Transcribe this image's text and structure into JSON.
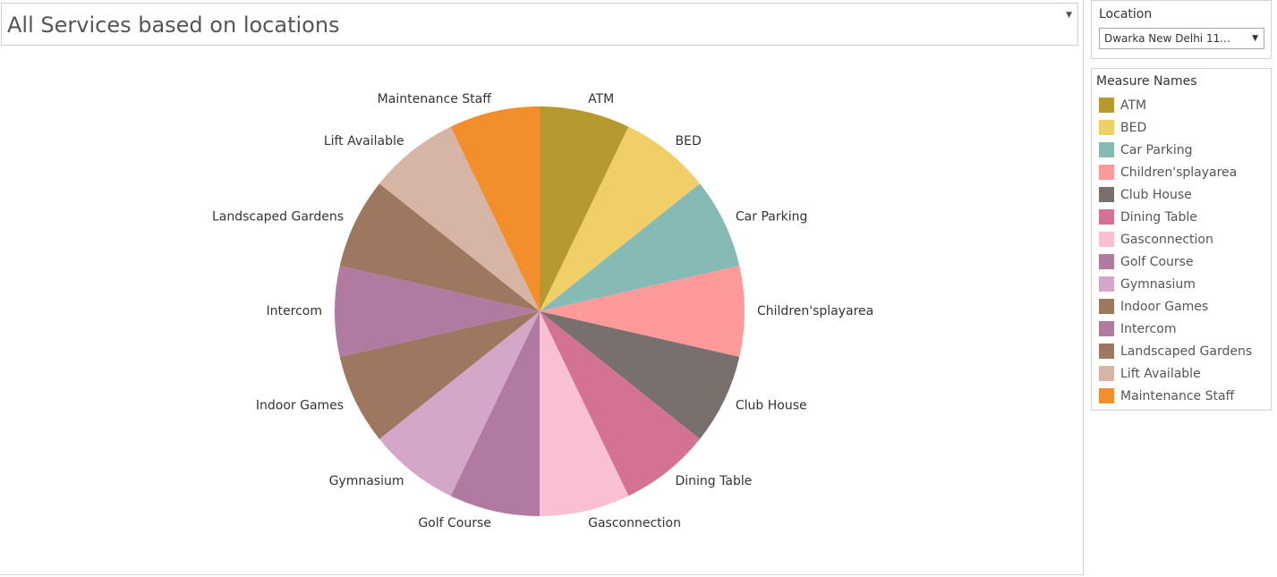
{
  "title": {
    "text": "All Services based on locations"
  },
  "filter": {
    "label": "Location",
    "selected": "Dwarka New Delhi 11..."
  },
  "legend": {
    "title": "Measure Names"
  },
  "chart_data": {
    "type": "pie",
    "categories": [
      "ATM",
      "BED",
      "Car Parking",
      "Children'splayarea",
      "Club House",
      "Dining Table",
      "Gasconnection",
      "Golf Course",
      "Gymnasium",
      "Indoor Games",
      "Intercom",
      "Landscaped Gardens",
      "Lift Available",
      "Maintenance Staff"
    ],
    "values": [
      1,
      1,
      1,
      1,
      1,
      1,
      1,
      1,
      1,
      1,
      1,
      1,
      1,
      1
    ],
    "colors": [
      "#b69a2f",
      "#f0ce68",
      "#86bbb5",
      "#fe9a99",
      "#79706e",
      "#d47294",
      "#f9bfd3",
      "#b07aa1",
      "#d4a6c8",
      "#9d7760",
      "#b07aa1",
      "#9d7760",
      "#d6b4a6",
      "#f28e2c"
    ],
    "title": "All Services based on locations",
    "legend_title": "Measure Names",
    "legend_position": "right",
    "start_angle": "12 o'clock",
    "direction": "clockwise"
  }
}
